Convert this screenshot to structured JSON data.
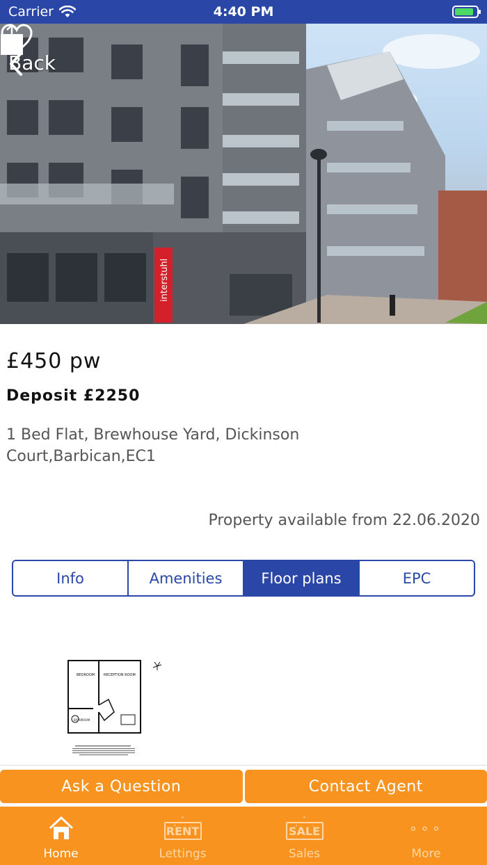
{
  "status_bar": {
    "carrier": "Carrier",
    "time": "4:40 PM"
  },
  "nav": {
    "back_label": "Back"
  },
  "hero": {
    "sign_text": "interstuhl"
  },
  "listing": {
    "price": "£450 pw",
    "deposit": "Deposit £2250",
    "address": "1 Bed Flat, Brewhouse Yard, Dickinson Court,Barbican,EC1",
    "availability": "Property available from 22.06.2020"
  },
  "tabs": [
    {
      "label": "Info",
      "active": false
    },
    {
      "label": "Amenities",
      "active": false
    },
    {
      "label": "Floor plans",
      "active": true
    },
    {
      "label": "EPC",
      "active": false
    }
  ],
  "floorplan": {
    "bedroom_label": "BEDROOM",
    "reception_label": "RECEPTION ROOM",
    "bathroom_label": "BATHROOM"
  },
  "actions": {
    "ask": "Ask a Question",
    "contact": "Contact Agent"
  },
  "tabbar": [
    {
      "label": "Home",
      "icon": "home-icon",
      "active": true
    },
    {
      "label": "Lettings",
      "icon": "rent-sign-icon",
      "badge": "RENT",
      "active": false
    },
    {
      "label": "Sales",
      "icon": "sale-sign-icon",
      "badge": "SALE",
      "active": false
    },
    {
      "label": "More",
      "icon": "more-dots-icon",
      "active": false
    }
  ],
  "colors": {
    "brand_blue": "#2a47a8",
    "brand_orange": "#f7931e",
    "battery_green": "#4cd964"
  }
}
